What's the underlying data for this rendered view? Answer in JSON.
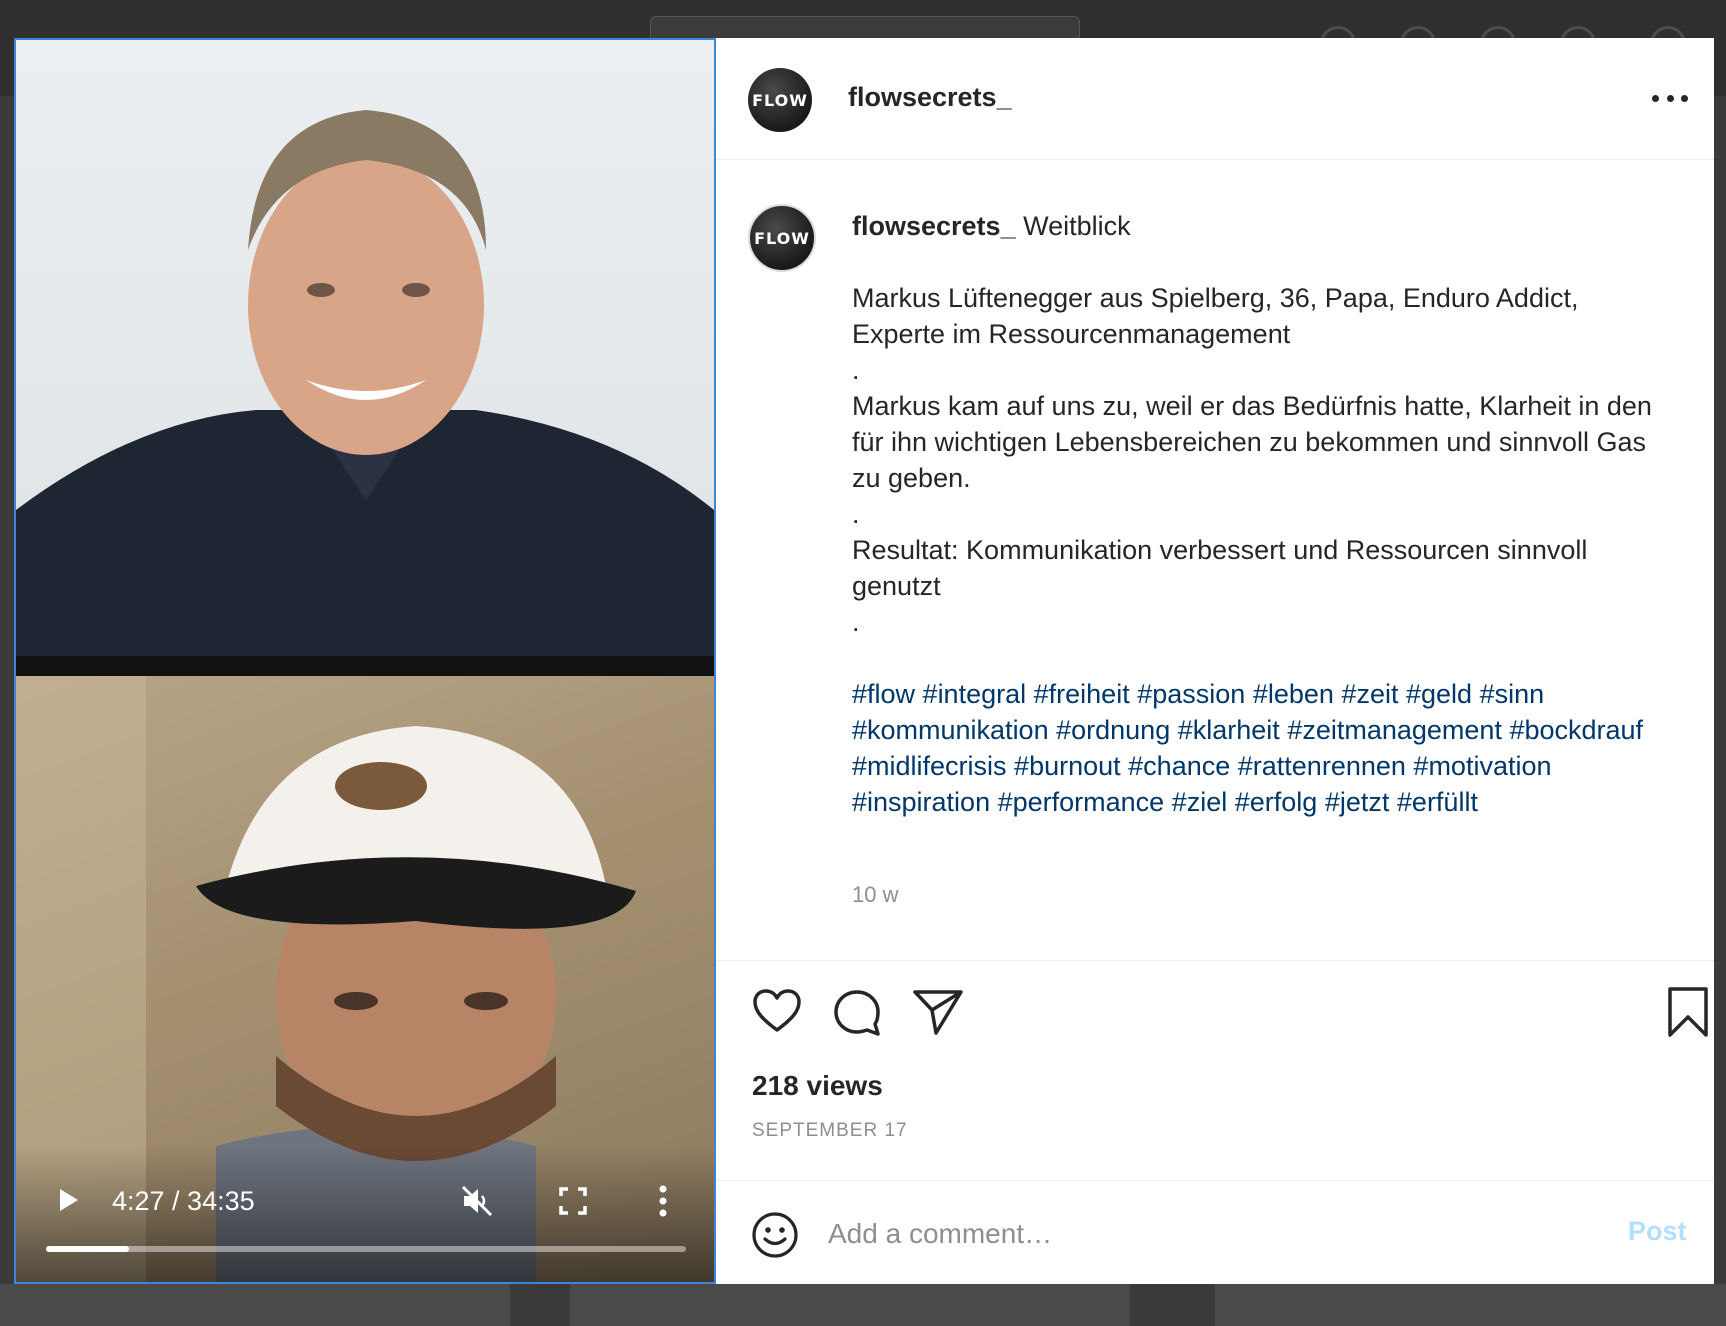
{
  "post": {
    "username": "flowsecrets_",
    "avatar_text": "FLOW",
    "caption": {
      "username": "flowsecrets_",
      "title": "Weitblick",
      "line1": "Markus Lüftenegger aus Spielberg, 36, Papa, Enduro Addict, Experte im Ressourcenmanagement",
      "sep1": ".",
      "line2": "Markus kam auf uns zu, weil er das Bedürfnis hatte, Klarheit in den für ihn wichtigen Lebensbereichen zu bekommen und sinnvoll Gas zu geben.",
      "sep2": ".",
      "line3": "Resultat: Kommunikation verbessert und Ressourcen sinnvoll genutzt",
      "sep3": ".",
      "hashtags": [
        "#flow",
        "#integral",
        "#freiheit",
        "#passion",
        "#leben",
        "#zeit",
        "#geld",
        "#sinn",
        "#kommunikation",
        "#ordnung",
        "#klarheit",
        "#zeitmanagement",
        "#bockdrauf",
        "#midlifecrisis",
        "#burnout",
        "#chance",
        "#rattenrennen",
        "#motivation",
        "#inspiration",
        "#performance",
        "#ziel",
        "#erfolg",
        "#jetzt",
        "#erfüllt"
      ]
    },
    "age": "10 w",
    "views": "218 views",
    "date": "SEPTEMBER 17"
  },
  "video": {
    "time": "4:27 / 34:35",
    "progress": 0.13,
    "muted": true
  },
  "comment": {
    "placeholder": "Add a comment…",
    "post_label": "Post"
  },
  "colors": {
    "hashtag": "#00376b",
    "post_button_disabled": "#b2dffc",
    "muted_text": "#8e8e8e"
  },
  "icons": {
    "like": "heart-icon",
    "comment": "speech-bubble-icon",
    "share": "paper-plane-icon",
    "save": "bookmark-icon",
    "emoji": "smiley-icon",
    "more": "ellipsis-icon",
    "play": "play-icon",
    "mute": "speaker-muted-icon",
    "fullscreen": "fullscreen-icon",
    "video_menu": "vertical-ellipsis-icon"
  }
}
